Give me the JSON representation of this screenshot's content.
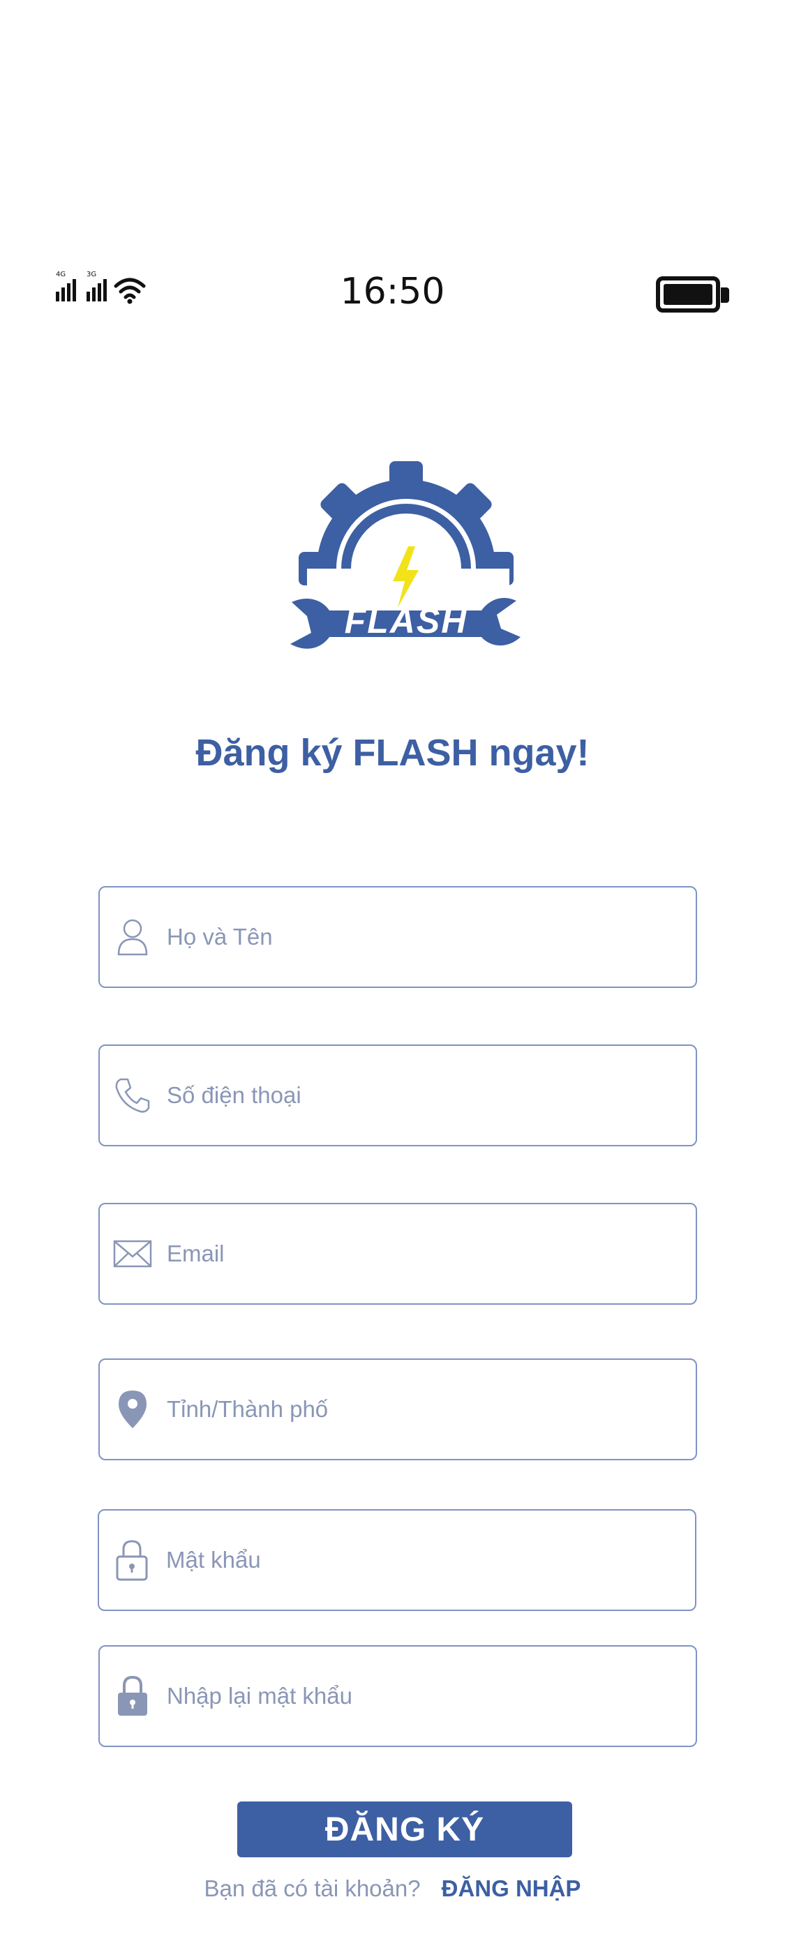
{
  "status_bar": {
    "time": "16:50",
    "signal_1_label": "4G",
    "signal_2_label": "3G"
  },
  "logo": {
    "text": "FLASH",
    "icon": "gear-wrench-lightning-logo",
    "colors": {
      "primary": "#3d5fa3",
      "bolt": "#f2e21a"
    }
  },
  "page": {
    "title": "Đăng ký FLASH ngay!"
  },
  "form": {
    "fields": [
      {
        "placeholder": "Họ và Tên",
        "icon": "user-icon",
        "value": ""
      },
      {
        "placeholder": "Số điện thoại",
        "icon": "phone-icon",
        "value": ""
      },
      {
        "placeholder": "Email",
        "icon": "mail-icon",
        "value": ""
      },
      {
        "placeholder": "Tỉnh/Thành phố",
        "icon": "location-pin-icon",
        "value": ""
      },
      {
        "placeholder": "Mật khẩu",
        "icon": "lock-outline-icon",
        "value": ""
      },
      {
        "placeholder": "Nhập lại mật khẩu",
        "icon": "lock-filled-icon",
        "value": ""
      }
    ],
    "submit_label": "ĐĂNG KÝ"
  },
  "footer": {
    "question": "Bạn đã có tài khoản?",
    "login_label": "ĐĂNG NHẬP"
  }
}
